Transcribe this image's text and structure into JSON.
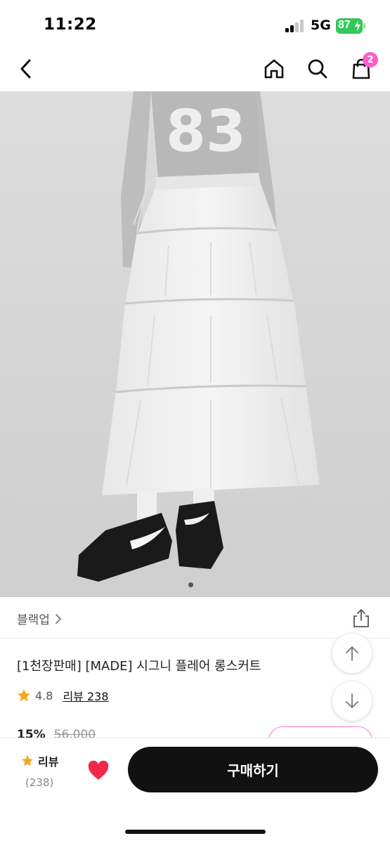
{
  "status_bar": {
    "time": "11:22",
    "network": "5G",
    "battery": "87"
  },
  "header": {
    "back_icon": "chevron-left-icon",
    "home_icon": "home-icon",
    "search_icon": "search-icon",
    "cart_icon": "shopping-bag-icon",
    "cart_count": "2"
  },
  "gallery": {
    "total_images": 2,
    "active_index": 0
  },
  "product": {
    "brand": "블랙업",
    "title": "[1천장판매] [MADE] 시그니 플레어 롱스커트",
    "rating": "4.8",
    "review_link": "리뷰 238",
    "discount": "15%",
    "original_price": "56,000"
  },
  "floating": {
    "scroll_up_icon": "arrow-up-icon",
    "scroll_down_icon": "arrow-down-icon",
    "share_icon": "share-icon"
  },
  "bottom_bar": {
    "review_label": "리뷰",
    "review_count": "(238)",
    "buy_label": "구매하기",
    "like_icon": "heart-icon"
  },
  "colors": {
    "accent": "#ff5ecb",
    "star": "#f5a623",
    "heart": "#f0284a",
    "buy_button": "#111111",
    "battery": "#34c759"
  }
}
